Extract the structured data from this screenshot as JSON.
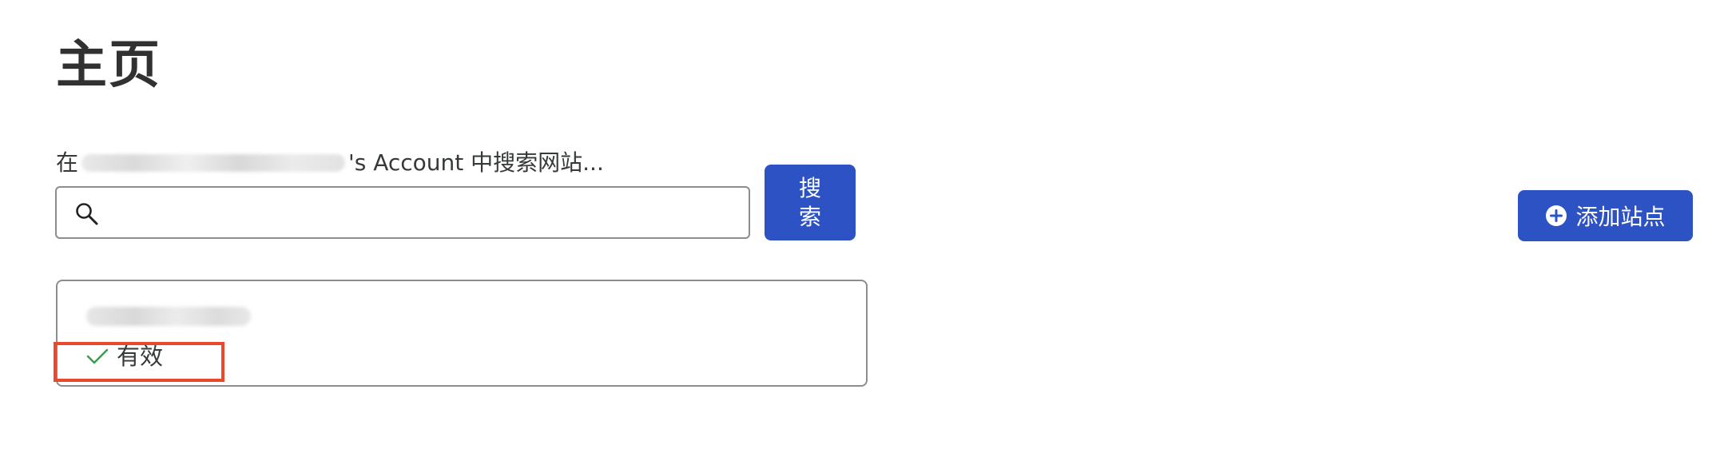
{
  "page": {
    "title": "主页"
  },
  "search": {
    "label_prefix": "在",
    "label_suffix": "'s Account 中搜索网站...",
    "input_value": "",
    "button_label": "搜索",
    "icon": "search-icon"
  },
  "actions": {
    "add_site_label": "添加站点",
    "add_site_icon": "plus-circle-icon"
  },
  "site_card": {
    "status_label": "有效",
    "status_icon": "check-icon",
    "status_color": "#3c9b4a"
  },
  "colors": {
    "accent": "#2c52c4",
    "highlight": "#e8492c"
  }
}
